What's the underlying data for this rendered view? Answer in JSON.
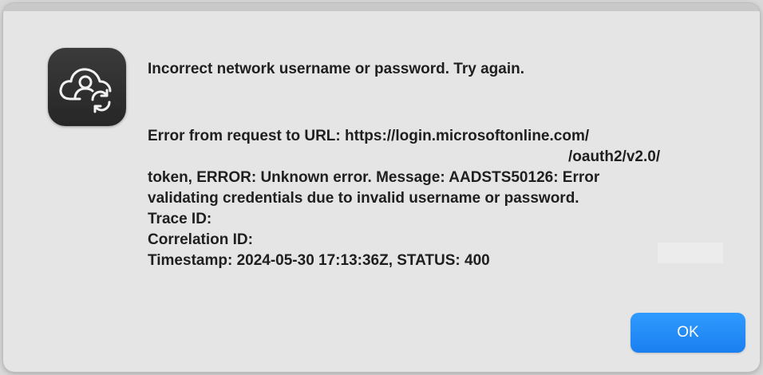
{
  "dialog": {
    "headline": "Incorrect network username or password. Try again.",
    "message_lines": [
      "Error from request to URL: https://login.microsoftonline.com/",
      "/oauth2/v2.0/",
      "token, ERROR: Unknown error. Message: AADSTS50126: Error",
      "validating credentials due to invalid username or password.",
      "Trace ID:",
      "Correlation ID:",
      "Timestamp: 2024-05-30 17:13:36Z, STATUS: 400"
    ],
    "ok_label": "OK"
  },
  "icons": {
    "app_icon": "cloud-user-sync-icon"
  },
  "colors": {
    "accent": "#1a7ff0",
    "dialog_bg": "#e5e5e5",
    "icon_bg": "#2e2e2e"
  }
}
